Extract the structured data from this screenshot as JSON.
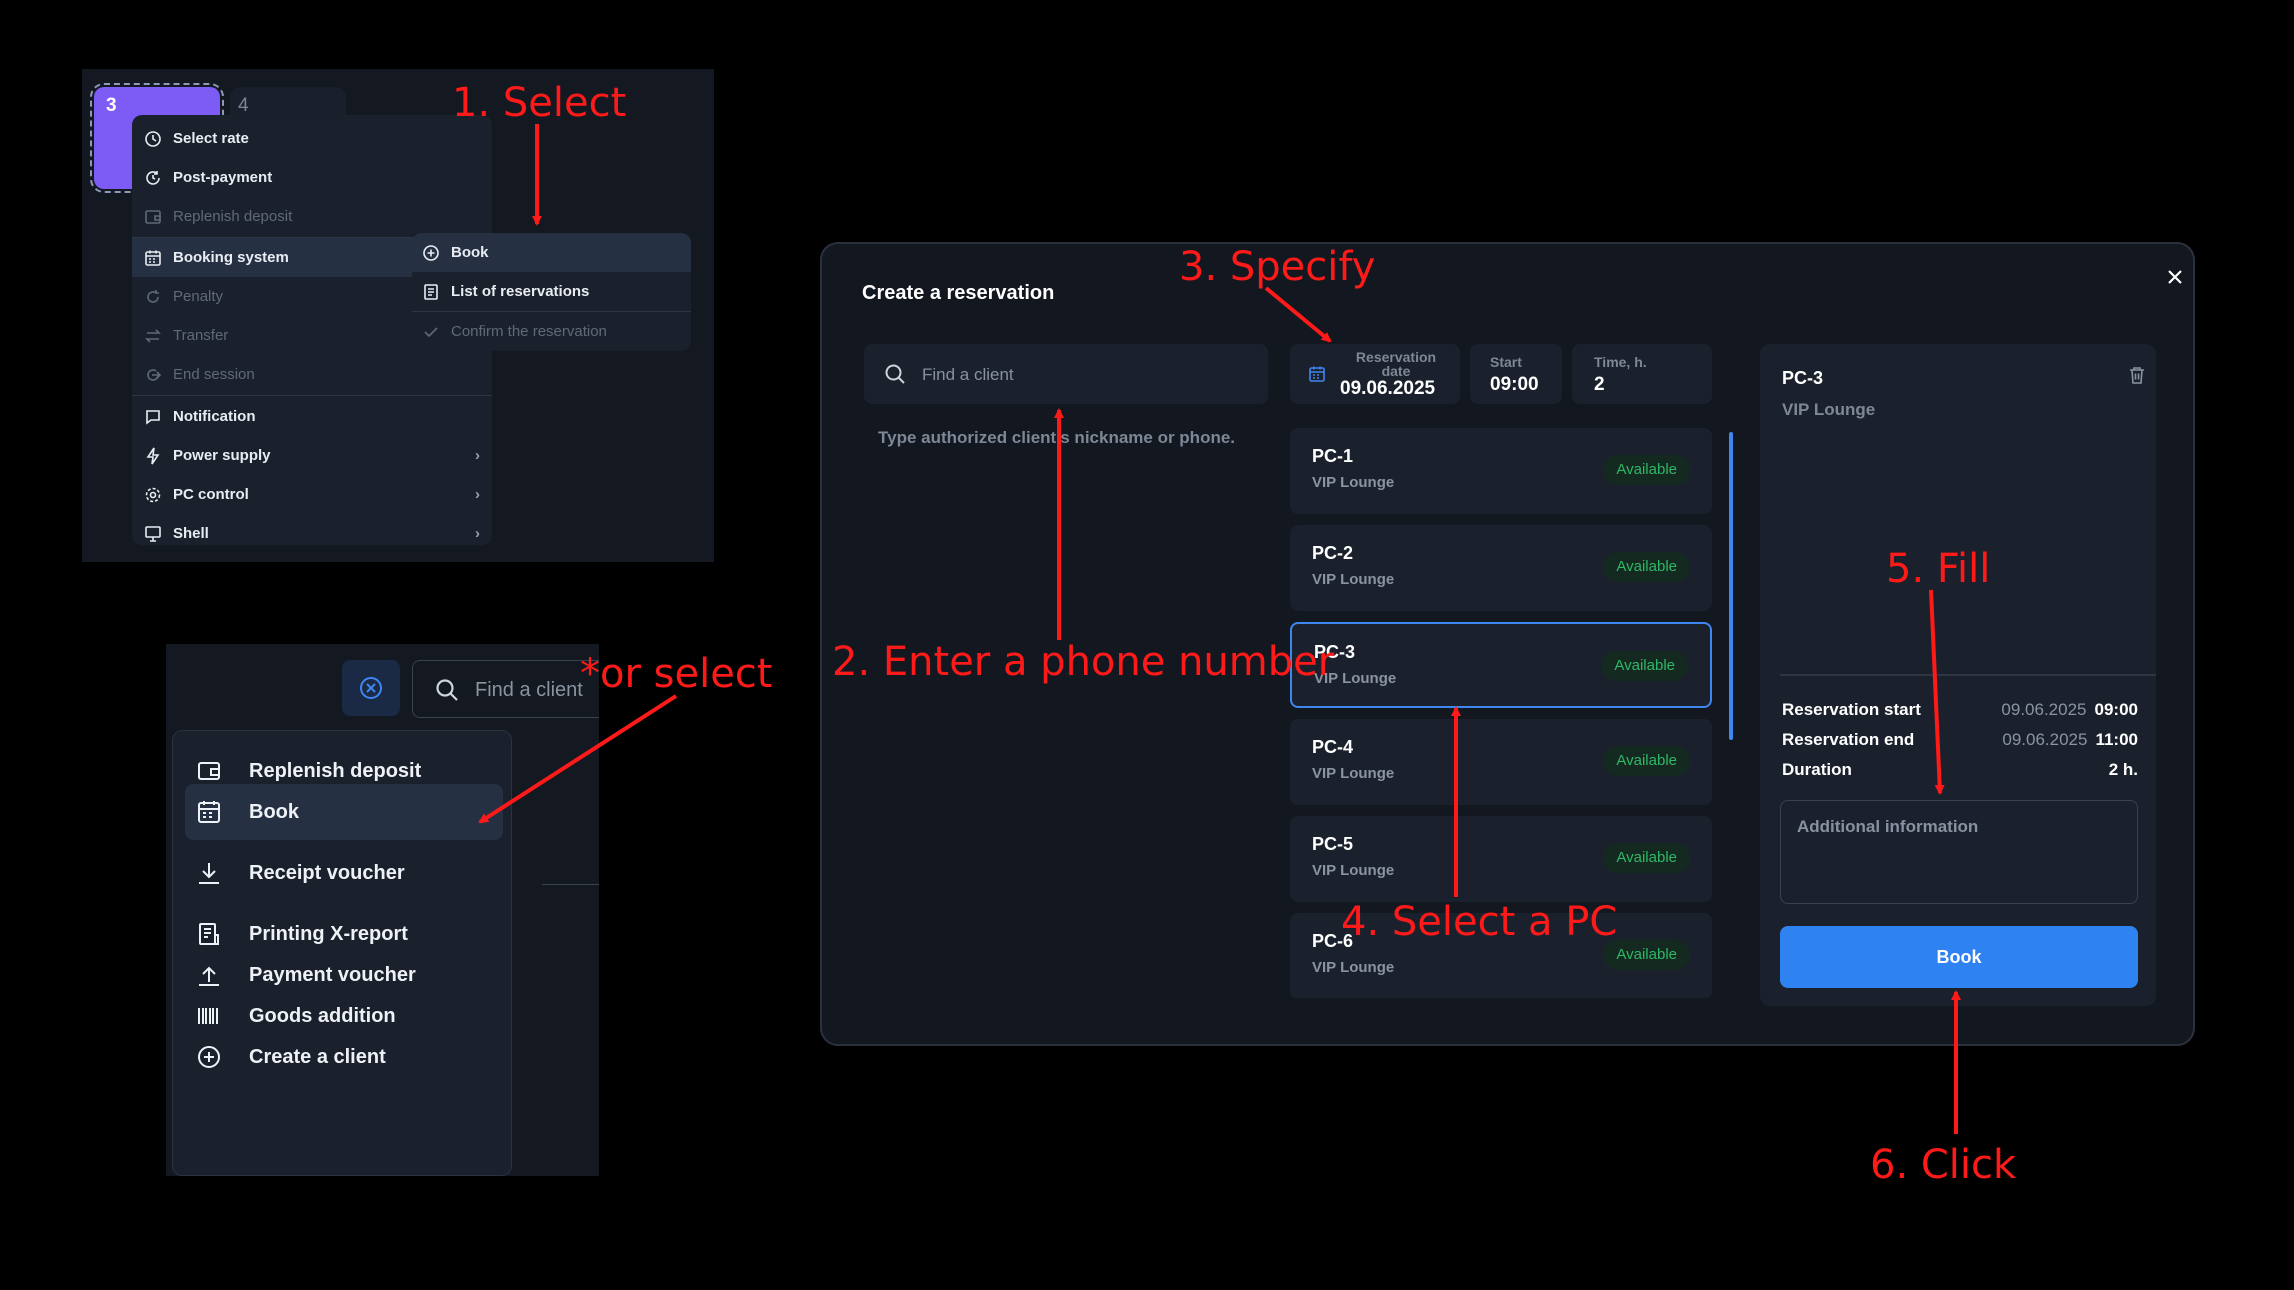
{
  "colors": {
    "background": "#000000",
    "panel": "#131821",
    "menu": "#1b212c",
    "highlight": "#263043",
    "accent": "#2f82f2",
    "tile_purple": "#7c5cf5",
    "available_green": "#2eb867",
    "annotation_red": "#ff1a1a"
  },
  "context_menu": {
    "tiles": {
      "active": "3",
      "next": "4"
    },
    "items": [
      {
        "label": "Select rate",
        "icon": "clock-icon"
      },
      {
        "label": "Post-payment",
        "icon": "post-payment-icon"
      },
      {
        "label": "Replenish deposit",
        "icon": "wallet-icon"
      },
      {
        "label": "Booking system",
        "icon": "calendar-icon"
      },
      {
        "label": "Penalty",
        "icon": "penalty-icon"
      },
      {
        "label": "Transfer",
        "icon": "transfer-icon"
      },
      {
        "label": "End session",
        "icon": "end-session-icon"
      },
      {
        "label": "Notification",
        "icon": "message-icon"
      },
      {
        "label": "Power supply",
        "icon": "lightning-icon"
      },
      {
        "label": "PC control",
        "icon": "gear-icon"
      },
      {
        "label": "Shell",
        "icon": "monitor-icon"
      }
    ],
    "submenu": [
      {
        "label": "Book",
        "icon": "plus-circle-icon"
      },
      {
        "label": "List of reservations",
        "icon": "list-icon"
      },
      {
        "label": "Confirm the reservation",
        "icon": "check-icon"
      }
    ]
  },
  "quick_menu": {
    "search_placeholder": "Find a client",
    "items": [
      {
        "label": "Replenish deposit",
        "icon": "wallet-icon"
      },
      {
        "label": "Book",
        "icon": "calendar-icon"
      },
      {
        "label": "Receipt voucher",
        "icon": "download-icon"
      },
      {
        "label": "Printing X-report",
        "icon": "report-icon"
      },
      {
        "label": "Payment voucher",
        "icon": "upload-icon"
      },
      {
        "label": "Goods addition",
        "icon": "barcode-icon"
      },
      {
        "label": "Create a client",
        "icon": "plus-circle-icon"
      }
    ]
  },
  "dialog": {
    "title": "Create a reservation",
    "search_placeholder": "Find a client",
    "search_hint": "Type authorized client's nickname or phone.",
    "fields": {
      "date_label": "Reservation date",
      "date_value": "09.06.2025",
      "start_label": "Start",
      "start_value": "09:00",
      "time_label": "Time, h.",
      "time_value": "2"
    },
    "pcs": [
      {
        "name": "PC-1",
        "zone": "VIP Lounge",
        "status": "Available"
      },
      {
        "name": "PC-2",
        "zone": "VIP Lounge",
        "status": "Available"
      },
      {
        "name": "PC-3",
        "zone": "VIP Lounge",
        "status": "Available"
      },
      {
        "name": "PC-4",
        "zone": "VIP Lounge",
        "status": "Available"
      },
      {
        "name": "PC-5",
        "zone": "VIP Lounge",
        "status": "Available"
      },
      {
        "name": "PC-6",
        "zone": "VIP Lounge",
        "status": "Available"
      }
    ],
    "selected_pc": "PC-3",
    "summary": {
      "pc": "PC-3",
      "zone": "VIP Lounge",
      "start_label": "Reservation start",
      "start_date": "09.06.2025",
      "start_time": "09:00",
      "end_label": "Reservation end",
      "end_date": "09.06.2025",
      "end_time": "11:00",
      "duration_label": "Duration",
      "duration_value": "2 h.",
      "info_placeholder": "Additional information",
      "book_label": "Book"
    }
  },
  "annotations": {
    "step1": "1. Select",
    "step2": "2. Enter a phone number",
    "step3": "3. Specify",
    "step4": "4. Select a PC",
    "step5": "5. Fill",
    "step6": "6. Click",
    "or_select": "*or select"
  }
}
